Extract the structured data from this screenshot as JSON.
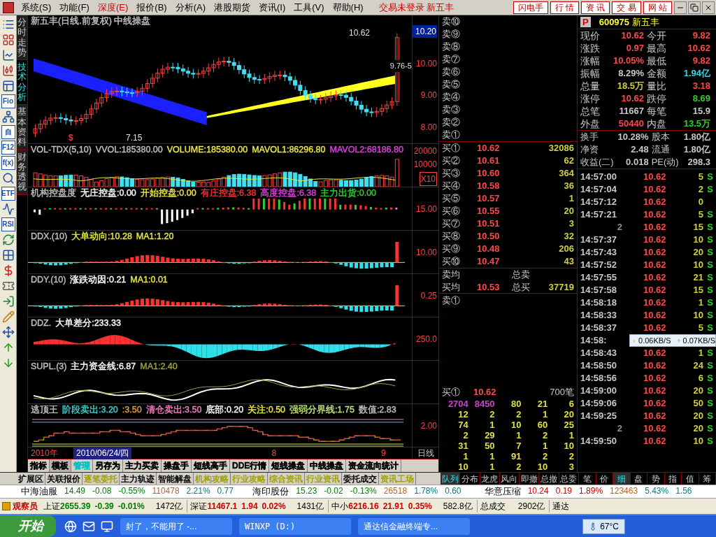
{
  "menu": [
    {
      "label": "系统(S)",
      "selected": false
    },
    {
      "label": "功能(F)",
      "selected": false
    },
    {
      "label": "深度(E)",
      "selected": true
    },
    {
      "label": "报价(B)",
      "selected": false
    },
    {
      "label": "分析(A)",
      "selected": false
    },
    {
      "label": "港股期货",
      "selected": false
    },
    {
      "label": "资讯(I)",
      "selected": false
    },
    {
      "label": "工具(V)",
      "selected": false
    },
    {
      "label": "帮助(H)",
      "selected": false
    }
  ],
  "login_status": "交易未登录 新五丰",
  "top_buttons": [
    "闪电手",
    "行 情",
    "资 讯",
    "交 易",
    "网 站"
  ],
  "toolbar": [
    {
      "kind": "icon"
    },
    {
      "kind": "icon"
    },
    {
      "kind": "icon"
    },
    {
      "kind": "icon"
    },
    {
      "kind": "icon"
    },
    {
      "kind": "text",
      "label": "Fio"
    },
    {
      "kind": "icon"
    },
    {
      "kind": "text",
      "label": "自"
    },
    {
      "kind": "text",
      "label": "F12"
    },
    {
      "kind": "text",
      "label": "f(x)"
    },
    {
      "kind": "icon"
    },
    {
      "kind": "text",
      "label": "ETF"
    },
    {
      "kind": "icon"
    },
    {
      "kind": "text",
      "label": "RSI"
    },
    {
      "kind": "icon"
    },
    {
      "kind": "icon"
    },
    {
      "kind": "icon"
    },
    {
      "kind": "icon"
    },
    {
      "kind": "icon"
    },
    {
      "kind": "icon"
    },
    {
      "kind": "icon"
    },
    {
      "kind": "icon"
    },
    {
      "kind": "icon"
    }
  ],
  "side_tabs": [
    {
      "label": "分时走势",
      "selected": false
    },
    {
      "label": "技术分析",
      "selected": true
    },
    {
      "label": "基本资料",
      "selected": false
    },
    {
      "label": "财务透视",
      "selected": false
    }
  ],
  "panels": [
    {
      "kind": "candles",
      "labels": [
        {
          "text": "新五丰(日线.前复权) 中线操盘",
          "color": "#c0c0c0"
        }
      ],
      "axis": [
        {
          "text": "10.20",
          "highlighted": true
        },
        {
          "text": "10.00",
          "highlighted": false
        },
        {
          "text": "9.00",
          "highlighted": false
        },
        {
          "text": "8.00",
          "highlighted": false
        }
      ],
      "annotations": [
        "10.62",
        "9.76-5",
        "7.15",
        "$"
      ]
    },
    {
      "kind": "volume",
      "labels": [
        {
          "text": "VOL-TDX(5,10)",
          "color": "#c0c0c0"
        },
        {
          "text": "VVOL:185380.00",
          "color": "#c0c0c0"
        },
        {
          "text": "VOLUME:185380.00",
          "color": "#e8e840"
        },
        {
          "text": "MAVOL1:86296.80",
          "color": "#e8e840"
        },
        {
          "text": "MAVOL2:68186.80",
          "color": "#e040e0"
        }
      ],
      "axis": [
        {
          "text": "20000",
          "highlighted": false
        },
        {
          "text": "10000",
          "highlighted": false
        },
        {
          "text": "X10",
          "highlighted": true
        }
      ]
    },
    {
      "kind": "control",
      "labels": [
        {
          "text": "机构控盘度",
          "color": "#c0c0c0"
        },
        {
          "text": "无庄控盘:0.00",
          "color": "#ffffff"
        },
        {
          "text": "开始控盘:0.00",
          "color": "#e8e840"
        },
        {
          "text": "有庄控盘:6.38",
          "color": "#ff3030"
        },
        {
          "text": "高度控盘:6.38",
          "color": "#e040e0"
        },
        {
          "text": "主力出货:0.00",
          "color": "#30d030"
        }
      ],
      "axis": [
        {
          "text": "15.00",
          "highlighted": false
        }
      ]
    },
    {
      "kind": "bars",
      "labels": [
        {
          "text": "DDX.(10)",
          "color": "#c0c0c0"
        },
        {
          "text": "大单动向:10.28",
          "color": "#e8e840"
        },
        {
          "text": "MA1:1.20",
          "color": "#e8e840"
        }
      ],
      "axis": [
        {
          "text": "10.00",
          "highlighted": false
        }
      ]
    },
    {
      "kind": "bars",
      "labels": [
        {
          "text": "DDY.(10)",
          "color": "#c0c0c0"
        },
        {
          "text": "涨跌动因:0.21",
          "color": "#ffffff"
        },
        {
          "text": "MA1:0.01",
          "color": "#e8e840"
        }
      ],
      "axis": [
        {
          "text": "0.25",
          "highlighted": false
        }
      ]
    },
    {
      "kind": "area",
      "labels": [
        {
          "text": "DDZ.",
          "color": "#c0c0c0"
        },
        {
          "text": "大单差分:233.33",
          "color": "#ffffff"
        }
      ],
      "axis": [
        {
          "text": "250.0",
          "highlighted": false
        }
      ]
    },
    {
      "kind": "lines",
      "labels": [
        {
          "text": "SUPL.(3)",
          "color": "#c0c0c0"
        },
        {
          "text": "主力资金线:6.87",
          "color": "#ffffff"
        },
        {
          "text": "MA1:2.40",
          "color": "#a0a040"
        }
      ]
    },
    {
      "kind": "steps",
      "labels": [
        {
          "text": "逃顶王",
          "color": "#c0c0c0"
        },
        {
          "text": "阶段卖出:3.20",
          "color": "#40d0d0"
        },
        {
          "text": ":3.50",
          "color": "#e0a040"
        },
        {
          "text": "清仓卖出:3.50",
          "color": "#f080c0"
        },
        {
          "text": "底部:0.20",
          "color": "#ffffff"
        },
        {
          "text": "关注:0.50",
          "color": "#e8e840"
        },
        {
          "text": "强弱分界线:1.75",
          "color": "#c0e080"
        },
        {
          "text": "数值:2.83",
          "color": "#c0c0c0"
        }
      ],
      "axis": [
        {
          "text": "2.00",
          "highlighted": false
        }
      ]
    }
  ],
  "date_bar": {
    "year": "2010年",
    "cursor_date": "2010/06/24/四",
    "months": [
      "8",
      "9"
    ],
    "period": "日线"
  },
  "chart_tabs": [
    {
      "label": "指标",
      "selected": false,
      "color": "#000000"
    },
    {
      "label": "模板",
      "selected": true,
      "color": "#000000"
    },
    {
      "label": "管理",
      "selected": false,
      "color": "#00c0c0"
    },
    {
      "label": "另存为",
      "selected": false,
      "color": "#000000"
    },
    {
      "label": "主力买卖",
      "selected": false,
      "color": "#000000"
    },
    {
      "label": "操盘手",
      "selected": false,
      "color": "#000000"
    },
    {
      "label": "短线高手",
      "selected": false,
      "color": "#000000"
    },
    {
      "label": "DDE行情",
      "selected": false,
      "color": "#000000"
    },
    {
      "label": "短线操盘",
      "selected": false,
      "color": "#000000"
    },
    {
      "label": "中线操盘",
      "selected": false,
      "color": "#000000"
    },
    {
      "label": "资金流向统计",
      "selected": false,
      "color": "#000000"
    }
  ],
  "extension_tabs": [
    {
      "label": "扩展区",
      "color": "#000000"
    },
    {
      "label": "关联报价",
      "color": "#000000"
    },
    {
      "label": "逐笔委托",
      "color": "#a0a000"
    },
    {
      "label": "主力轨迹",
      "color": "#000000"
    },
    {
      "label": "智能解盘",
      "color": "#000000"
    },
    {
      "label": "机构攻略",
      "color": "#a0a000"
    },
    {
      "label": "行业攻略",
      "color": "#a0a000"
    },
    {
      "label": "综合资讯",
      "color": "#a0a000"
    },
    {
      "label": "行业资讯",
      "color": "#a0a000"
    },
    {
      "label": "委托成交",
      "color": "#000000"
    },
    {
      "label": "资讯工场",
      "color": "#a0a000"
    }
  ],
  "order_book": {
    "sell_levels": [
      "卖⑩",
      "卖⑨",
      "卖⑧",
      "卖⑦",
      "卖⑥",
      "卖⑤",
      "卖④",
      "卖③",
      "卖②",
      "卖①"
    ],
    "buy_levels": [
      {
        "label": "买①",
        "price": "10.62",
        "volume": "32086"
      },
      {
        "label": "买②",
        "price": "10.61",
        "volume": "62"
      },
      {
        "label": "买③",
        "price": "10.60",
        "volume": "364"
      },
      {
        "label": "买④",
        "price": "10.58",
        "volume": "36"
      },
      {
        "label": "买⑤",
        "price": "10.57",
        "volume": "1"
      },
      {
        "label": "买⑥",
        "price": "10.55",
        "volume": "20"
      },
      {
        "label": "买⑦",
        "price": "10.51",
        "volume": "3"
      },
      {
        "label": "买⑧",
        "price": "10.50",
        "volume": "32"
      },
      {
        "label": "买⑨",
        "price": "10.48",
        "volume": "206"
      },
      {
        "label": "买⑩",
        "price": "10.47",
        "volume": "43"
      }
    ],
    "sell_avg_label": "卖均",
    "total_sell_label": "总卖",
    "buy_avg_label": "买均",
    "buy_avg": "10.53",
    "total_buy_label": "总买",
    "total_buy": "37719",
    "sell_queue_label": "卖①",
    "buy_queue": {
      "label": "买①",
      "price": "10.62",
      "count": "700笔"
    },
    "queue_rows": [
      [
        {
          "text": "2704",
          "color": "#d040d0"
        },
        {
          "text": "8450",
          "color": "#d040d0"
        },
        {
          "text": "80",
          "color": "#e0e040"
        },
        {
          "text": "21",
          "color": "#e0e040"
        },
        {
          "text": "6",
          "color": "#e0e040"
        }
      ],
      [
        "12",
        "2",
        "2",
        "1",
        "20"
      ],
      [
        "74",
        "1",
        "10",
        "60",
        "25"
      ],
      [
        "2",
        "29",
        "1",
        "2",
        "1"
      ],
      [
        "31",
        "50",
        "7",
        "1",
        "10"
      ],
      [
        "1",
        "1",
        "91",
        "2",
        "2"
      ],
      [
        "10",
        "1",
        "2",
        "10",
        "3"
      ]
    ],
    "tabs": [
      {
        "label": "队列",
        "selected": true
      },
      {
        "label": "分布",
        "selected": false
      },
      {
        "label": "龙虎",
        "selected": false
      },
      {
        "label": "风向",
        "selected": false
      },
      {
        "label": "即撤",
        "selected": false
      },
      {
        "label": "总撤",
        "selected": false
      },
      {
        "label": "总委",
        "selected": false
      }
    ]
  },
  "quote": {
    "badge": "P",
    "code": "600975",
    "name": "新五丰",
    "stats": [
      {
        "label": "现价",
        "value": "10.62",
        "color": "#ff4848"
      },
      {
        "label": "今开",
        "value": "9.82",
        "color": "#ff4848"
      },
      {
        "label": "涨跌",
        "value": "0.97",
        "color": "#ff4848"
      },
      {
        "label": "最高",
        "value": "10.62",
        "color": "#ff4848"
      },
      {
        "label": "涨幅",
        "value": "10.05%",
        "color": "#ff4848"
      },
      {
        "label": "最低",
        "value": "9.82",
        "color": "#ff4848"
      },
      {
        "label": "振幅",
        "value": "8.29%",
        "color": "#c8c8c8"
      },
      {
        "label": "金额",
        "value": "1.94亿",
        "color": "#30d8e8"
      },
      {
        "label": "总量",
        "value": "18.5万",
        "color": "#d0d040"
      },
      {
        "label": "量比",
        "value": "3.18",
        "color": "#ff4848"
      },
      {
        "label": "涨停",
        "value": "10.62",
        "color": "#ff4848"
      },
      {
        "label": "跌停",
        "value": "8.69",
        "color": "#30d030"
      },
      {
        "label": "总笔",
        "value": "11667",
        "color": "#c8c8c8"
      },
      {
        "label": "每笔",
        "value": "15.9",
        "color": "#c8c8c8"
      },
      {
        "label": "外盘",
        "value": "50440",
        "color": "#ff4848"
      },
      {
        "label": "内盘",
        "value": "13.5万",
        "color": "#30d030"
      }
    ],
    "fundamentals": [
      {
        "label": "换手",
        "value": "10.28%"
      },
      {
        "label": "股本",
        "value": "1.80亿"
      },
      {
        "label": "净资",
        "value": "2.48"
      },
      {
        "label": "流通",
        "value": "1.80亿"
      },
      {
        "label": "收益(二)",
        "value": "0.018"
      },
      {
        "label": "PE(动)",
        "value": "298.3"
      }
    ],
    "trades": [
      {
        "kind": "time",
        "time": "14:57:00",
        "price": "10.62",
        "volume": "5",
        "flag": "S"
      },
      {
        "kind": "time",
        "time": "14:57:04",
        "price": "10.62",
        "volume": "2",
        "flag": "S"
      },
      {
        "kind": "time",
        "time": "14:57:12",
        "price": "10.62",
        "volume": "0"
      },
      {
        "kind": "time",
        "time": "14:57:21",
        "price": "10.62",
        "volume": "5",
        "flag": "S"
      },
      {
        "kind": "count",
        "time": "2",
        "price": "10.62",
        "volume": "15",
        "flag": "S"
      },
      {
        "kind": "time",
        "time": "14:57:37",
        "price": "10.62",
        "volume": "10",
        "flag": "S"
      },
      {
        "kind": "time",
        "time": "14:57:43",
        "price": "10.62",
        "volume": "20",
        "flag": "S"
      },
      {
        "kind": "time",
        "time": "14:57:52",
        "price": "10.62",
        "volume": "10",
        "flag": "S"
      },
      {
        "kind": "time",
        "time": "14:57:55",
        "price": "10.62",
        "volume": "21",
        "flag": "S"
      },
      {
        "kind": "time",
        "time": "14:57:58",
        "price": "10.62",
        "volume": "15",
        "flag": "S"
      },
      {
        "kind": "time",
        "time": "14:58:18",
        "price": "10.62",
        "volume": "1",
        "flag": "S"
      },
      {
        "kind": "time",
        "time": "14:58:33",
        "price": "10.62",
        "volume": "10",
        "flag": "S"
      },
      {
        "kind": "time",
        "time": "14:58:37",
        "price": "10.62",
        "volume": "5",
        "flag": "S"
      },
      {
        "kind": "time",
        "time": "14:58:"
      },
      {
        "kind": "time",
        "time": "14:58:43",
        "price": "10.62",
        "volume": "1",
        "flag": "S"
      },
      {
        "kind": "time",
        "time": "14:58:50",
        "price": "10.62",
        "volume": "24",
        "flag": "S"
      },
      {
        "kind": "time",
        "time": "14:58:56",
        "price": "10.62",
        "volume": "6",
        "flag": "S"
      },
      {
        "kind": "time",
        "time": "14:59:00",
        "price": "10.62",
        "volume": "20",
        "flag": "S"
      },
      {
        "kind": "time",
        "time": "14:59:06",
        "price": "10.62",
        "volume": "50",
        "flag": "S"
      },
      {
        "kind": "time",
        "time": "14:59:25",
        "price": "10.62",
        "volume": "20",
        "flag": "S"
      },
      {
        "kind": "count",
        "time": "2",
        "price": "10.62",
        "volume": "20",
        "flag": "S"
      },
      {
        "kind": "time",
        "time": "14:59:50",
        "price": "10.62",
        "volume": "10",
        "flag": "S"
      }
    ],
    "tabs": [
      {
        "label": "笔",
        "selected": false
      },
      {
        "label": "价",
        "selected": false
      },
      {
        "label": "细",
        "selected": true
      },
      {
        "label": "盘",
        "selected": false
      },
      {
        "label": "势",
        "selected": false
      },
      {
        "label": "指",
        "selected": false
      },
      {
        "label": "值",
        "selected": false
      },
      {
        "label": "筹",
        "selected": false
      }
    ]
  },
  "network_tooltip": {
    "download": "0.06KB/S",
    "upload": "0.07KB/S"
  },
  "ticker": [
    {
      "name": "中海油服",
      "price": "14.49",
      "change": "-0.08",
      "pct": "-0.55%",
      "volume": "110478",
      "turnover": "2.21%",
      "ratio": "0.77",
      "color": "#008000"
    },
    {
      "name": "海印股份",
      "price": "15.23",
      "change": "-0.02",
      "pct": "-0.13%",
      "volume": "26518",
      "turnover": "1.78%",
      "ratio": "0.60",
      "color": "#008000"
    },
    {
      "name": "华意压缩",
      "price": "10.24",
      "change": "0.19",
      "pct": "1.89%",
      "volume": "123463",
      "turnover": "5.43%",
      "ratio": "1.56",
      "color": "#d00000"
    }
  ],
  "status_bar": {
    "observer": "观察员",
    "indices": [
      {
        "name": "上证",
        "value": "2655.39",
        "change": "-0.39",
        "pct": "-0.01%",
        "amount": "1472亿",
        "color": "#008000"
      },
      {
        "name": "深证",
        "value": "11467.1",
        "change": "1.94",
        "pct": "0.02%",
        "amount": "1431亿",
        "color": "#d00000"
      },
      {
        "name": "中小",
        "value": "6216.16",
        "change": "21.91",
        "pct": "0.35%",
        "amount": "582.8亿",
        "color": "#d00000"
      }
    ],
    "total_label": "总成交",
    "total": "2902亿",
    "trailing": "通达"
  },
  "taskbar": {
    "start": "开始",
    "tasks": [
      "封了，不能用了 -...",
      "WINXP (D:)",
      "通达信金融终端专..."
    ],
    "temperature": "67°C"
  }
}
